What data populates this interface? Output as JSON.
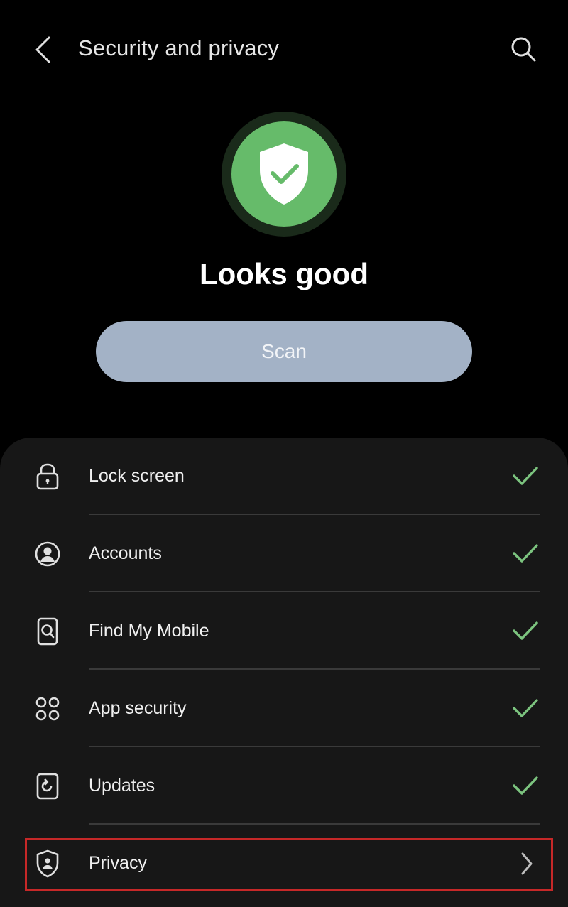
{
  "header": {
    "title": "Security and privacy",
    "back_icon": "chevron-left-icon",
    "search_icon": "search-icon"
  },
  "status": {
    "icon": "shield-check-icon",
    "text": "Looks good",
    "accent": "#66bb6a"
  },
  "scan_button": {
    "label": "Scan"
  },
  "items": [
    {
      "label": "Lock screen",
      "icon": "lock-icon",
      "status": "check"
    },
    {
      "label": "Accounts",
      "icon": "account-icon",
      "status": "check"
    },
    {
      "label": "Find My Mobile",
      "icon": "find-my-mobile-icon",
      "status": "check"
    },
    {
      "label": "App security",
      "icon": "app-grid-icon",
      "status": "check"
    },
    {
      "label": "Updates",
      "icon": "update-icon",
      "status": "check"
    },
    {
      "label": "Privacy",
      "icon": "privacy-shield-icon",
      "status": "chevron"
    }
  ],
  "colors": {
    "background": "#000000",
    "card": "#171717",
    "check": "#7cc47f",
    "scan_button": "#a3b2c6",
    "highlight": "#c62828"
  }
}
